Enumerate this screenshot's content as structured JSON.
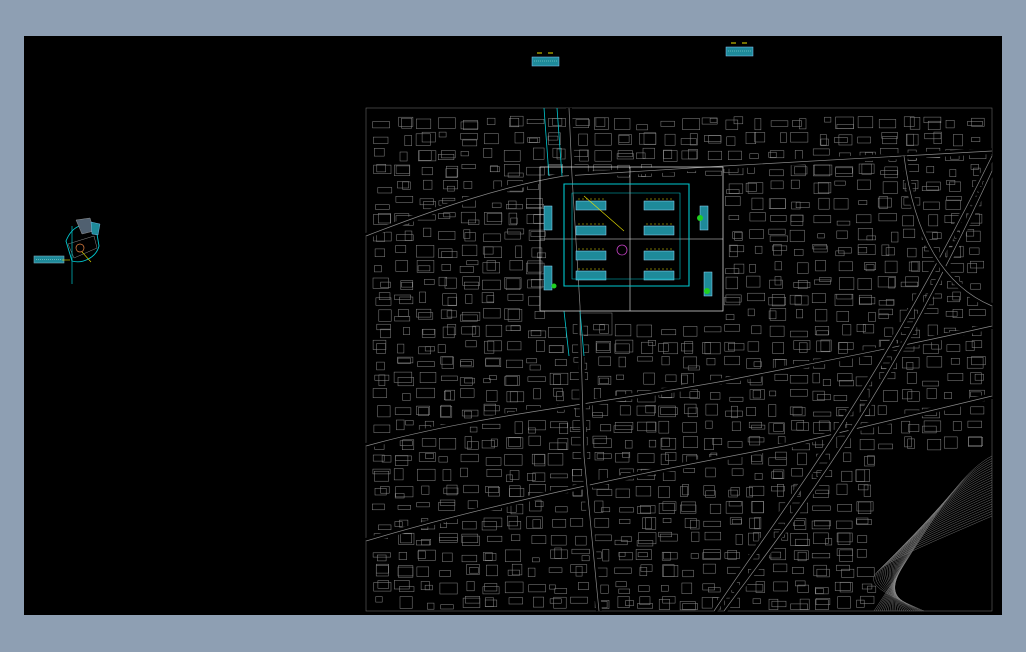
{
  "app": {
    "background_color": "#8e9fb3",
    "canvas_color": "#000000"
  },
  "drawing": {
    "site_map_line_color": "#8a8a8a",
    "site_boundary_color": "#00c8d0",
    "detail_frame_color": "#e8e8e8",
    "building_fill_color": "#1e8a9a",
    "accent_yellow": "#e8e000",
    "accent_green": "#20d020",
    "accent_magenta": "#c040c0"
  }
}
